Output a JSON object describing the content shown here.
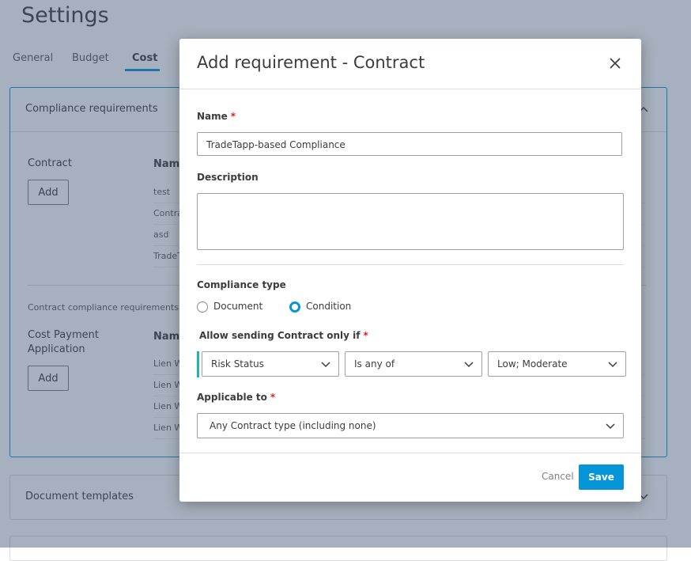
{
  "page": {
    "title": "Settings",
    "tabs": [
      {
        "label": "General"
      },
      {
        "label": "Budget"
      },
      {
        "label": "Cost"
      }
    ]
  },
  "panels": {
    "compliance": {
      "title": "Compliance requirements",
      "contract": {
        "label": "Contract",
        "add_label": "Add",
        "column_name": "Name",
        "rows": [
          "test",
          "Contra",
          "asd",
          "TradeT"
        ]
      },
      "note": "Contract compliance requirements mu",
      "cost_payment": {
        "label_line1": "Cost Payment",
        "label_line2": "Application",
        "add_label": "Add",
        "column_name": "Name",
        "rows": [
          "Lien W",
          "Lien W",
          "Lien W",
          "Lien W"
        ]
      }
    },
    "document_templates": {
      "title": "Document templates"
    }
  },
  "modal": {
    "title": "Add requirement - Contract",
    "name_label": "Name",
    "name_value": "TradeTapp-based Compliance",
    "description_label": "Description",
    "description_value": "",
    "compliance_type_label": "Compliance type",
    "options": {
      "document": "Document",
      "condition": "Condition",
      "selected": "condition"
    },
    "allow_label": "Allow sending Contract only if",
    "condition": {
      "field": "Risk Status",
      "operator": "Is any of",
      "values": "Low; Moderate"
    },
    "applicable_label": "Applicable to",
    "applicable_value": "Any Contract type (including none)",
    "required_mark": "*",
    "cancel_label": "Cancel",
    "save_label": "Save"
  },
  "colors": {
    "accent": "#0696d7",
    "teal": "#1fb5ad",
    "required": "#dd2222",
    "overlay": "rgba(60,80,110,0.45)"
  }
}
